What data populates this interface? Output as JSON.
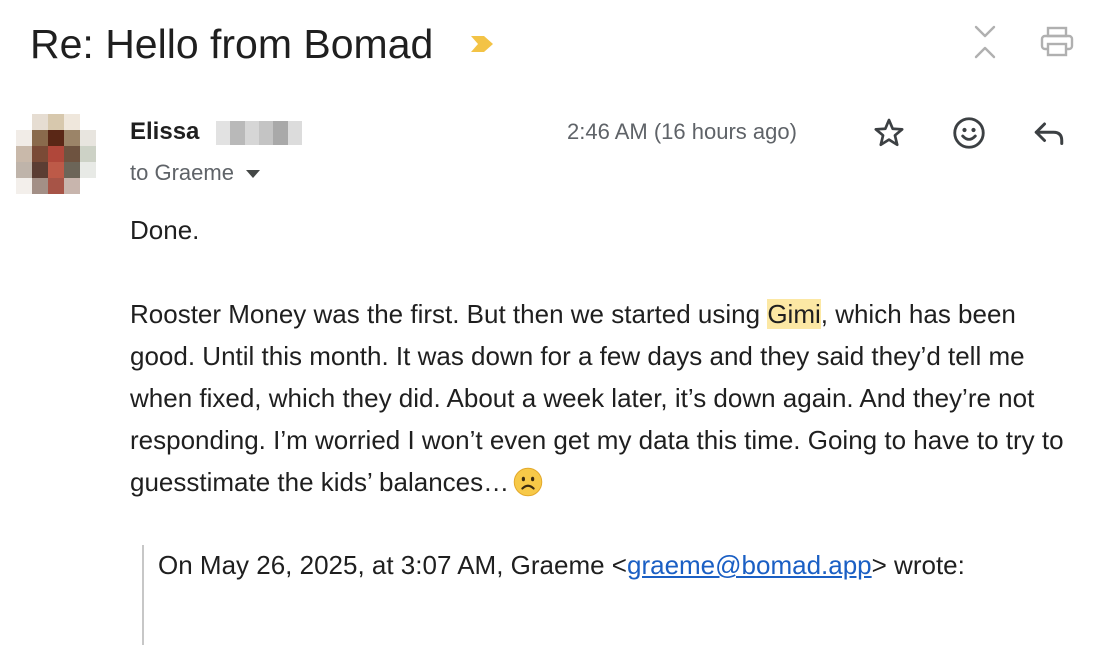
{
  "email": {
    "subject": "Re: Hello from Bomad",
    "sender_name": "Elissa",
    "recipient_line": "to Graeme",
    "timestamp": "2:46 AM (16 hours ago)",
    "body": {
      "greeting": "Done.",
      "para_before_highlight": "Rooster Money was the first. But then we started using ",
      "highlight_word": "Gimi",
      "para_after_highlight": ", which has been good. Until this month. It was down for a few days and they said they’d tell me when fixed, which they did. About a week later, it’s down again. And they’re not responding. I’m worried I won’t even get my data this time. Going to have to try to guesstimate the kids’ balances…"
    },
    "quote": {
      "prefix": "On May 26, 2025, at 3:07 AM, Graeme <",
      "email_link": "graeme@bomad.app",
      "suffix": "> wrote:"
    }
  },
  "icons": {
    "importance": "importance-marker-icon",
    "collapse": "collapse-all-icon",
    "print": "print-icon",
    "star": "star-icon",
    "emoji": "emoji-reaction-icon",
    "reply": "reply-icon",
    "sad_face": "sad-face-emoji-icon",
    "caret": "chevron-down-icon"
  },
  "colors": {
    "highlight": "#fce8a4",
    "link": "#1a5fc4",
    "importance": "#f3c346",
    "muted_text": "#5f6368",
    "emoji_face": "#f7c948"
  }
}
